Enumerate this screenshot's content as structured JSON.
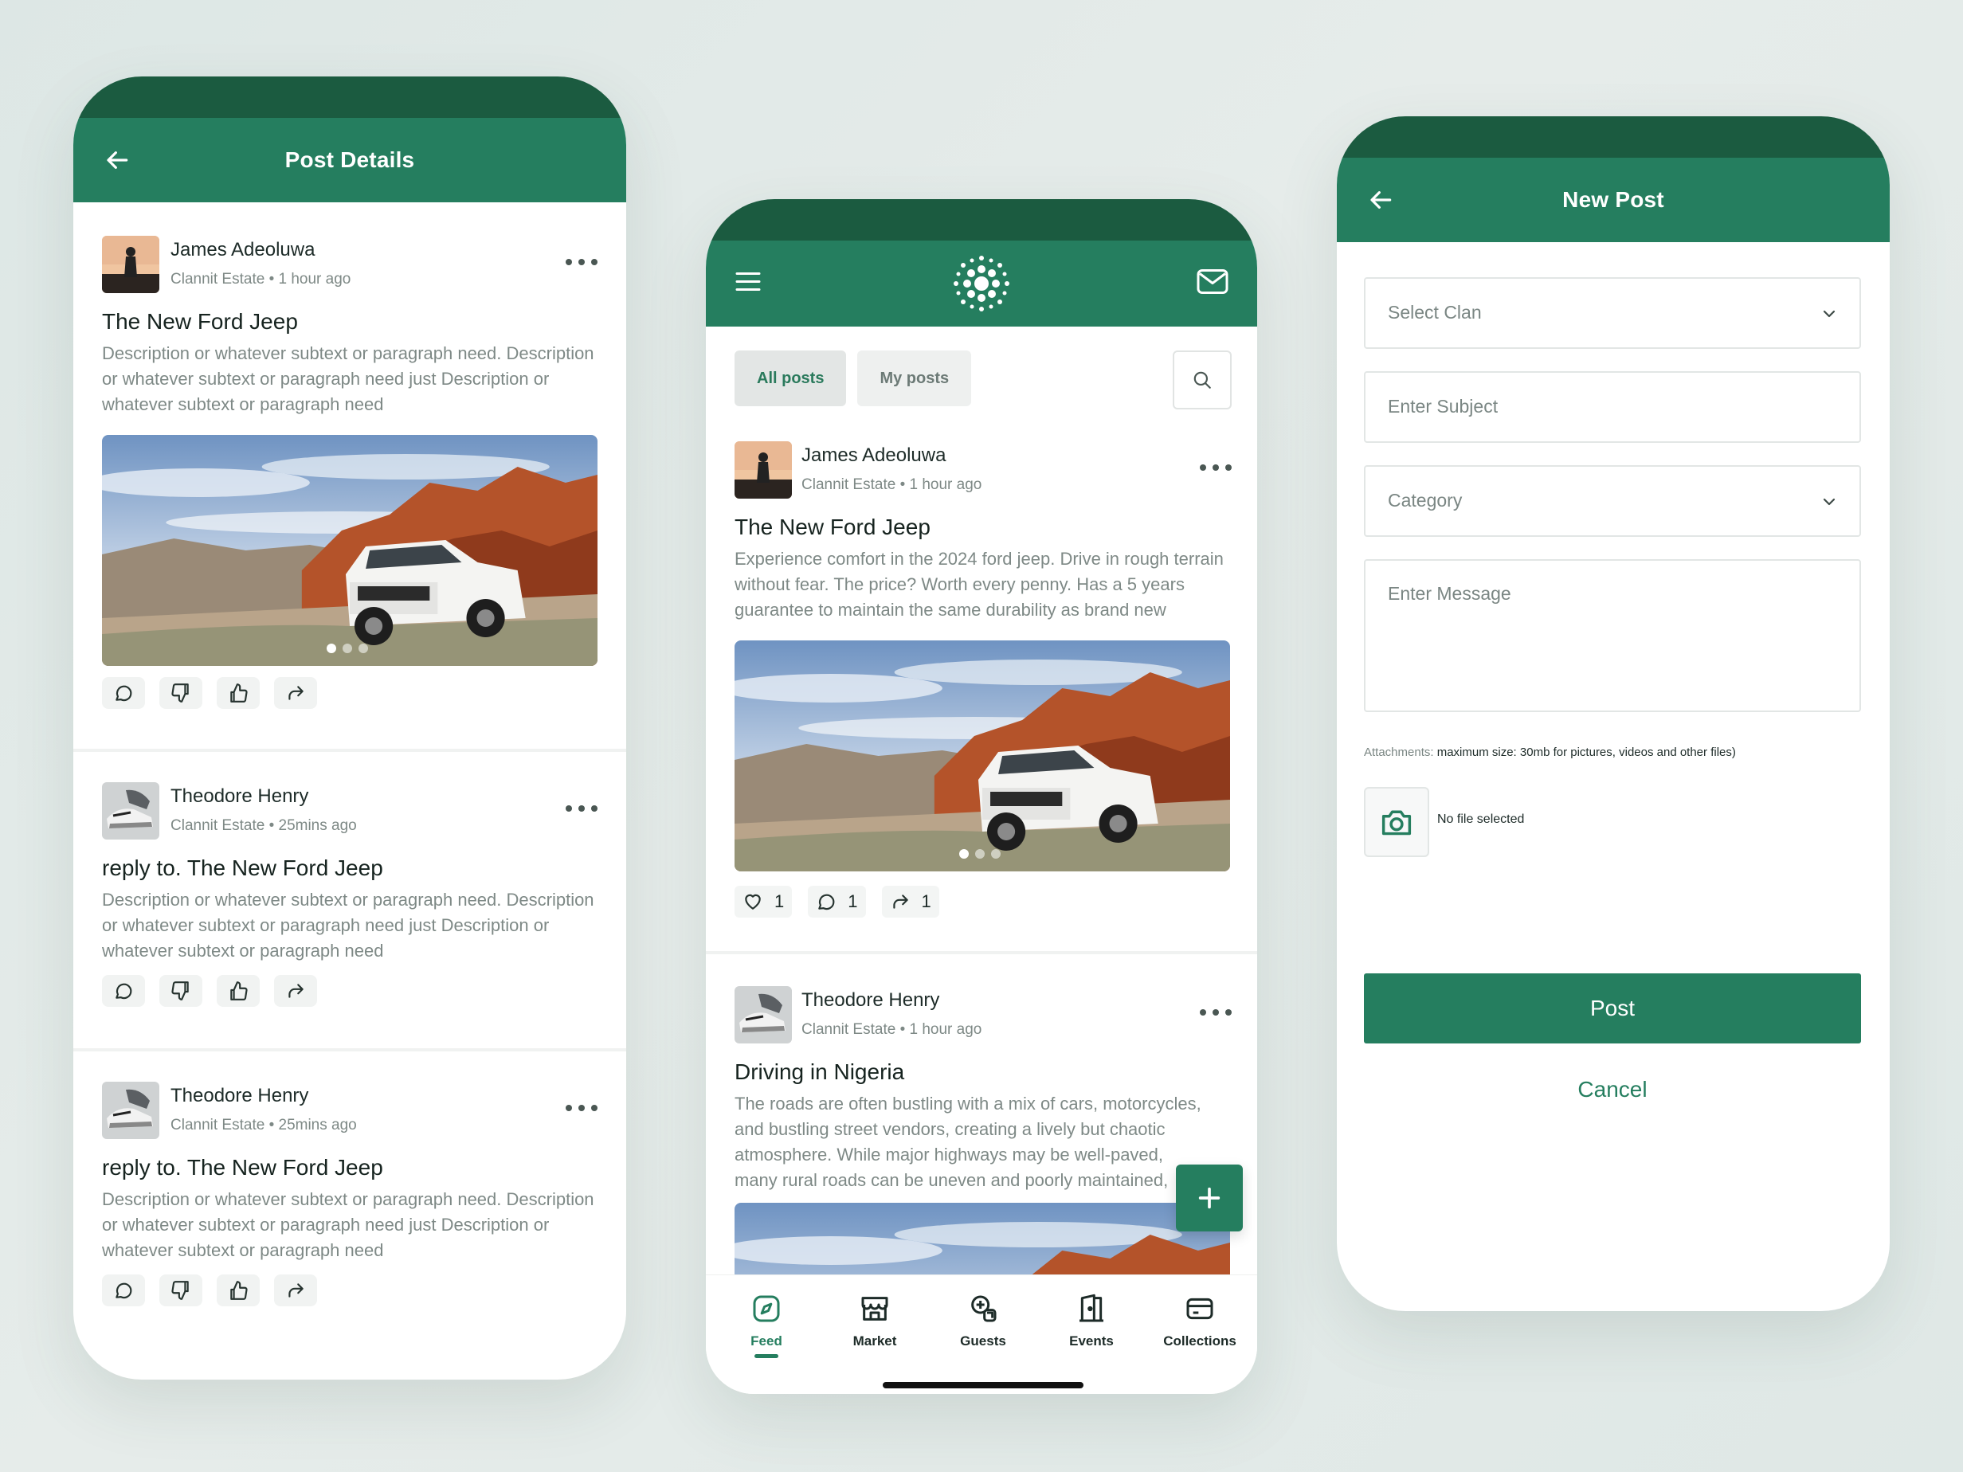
{
  "detail_screen": {
    "title": "Post Details",
    "posts": [
      {
        "author": "James Adeoluwa",
        "meta": "Clannit Estate • 1 hour ago",
        "title": "The New Ford Jeep",
        "desc": "Description or whatever subtext or paragraph need. Description or whatever subtext or paragraph need just Description or whatever subtext or paragraph need"
      },
      {
        "author": "Theodore Henry",
        "meta": "Clannit Estate • 25mins ago",
        "title": "reply to. The New Ford Jeep",
        "desc": "Description or whatever subtext or paragraph need. Description or whatever subtext or paragraph need just Description or whatever subtext or paragraph need"
      },
      {
        "author": "Theodore Henry",
        "meta": "Clannit Estate • 25mins ago",
        "title": "reply to. The New Ford Jeep",
        "desc": "Description or whatever subtext or paragraph need. Description or whatever subtext or paragraph need just Description or whatever subtext or paragraph need"
      }
    ]
  },
  "feed_screen": {
    "tabs": [
      "All posts",
      "My posts"
    ],
    "posts": [
      {
        "author": "James Adeoluwa",
        "meta": "Clannit Estate • 1 hour ago",
        "title": "The New Ford Jeep",
        "desc": "Experience comfort in the 2024 ford jeep. Drive in rough terrain without fear. The price? Worth every penny. Has a 5 years guarantee to maintain the same durability as brand new",
        "likes": "1",
        "comments": "1",
        "shares": "1"
      },
      {
        "author": "Theodore Henry",
        "meta": "Clannit Estate • 1 hour ago",
        "title": "Driving in Nigeria",
        "desc": "The roads are often bustling with a mix of cars, motorcycles, and bustling street vendors, creating a lively but chaotic atmosphere. While major highways may be well-paved, many rural roads can be uneven and poorly maintained, requiring cautious naviga"
      }
    ],
    "nav": [
      "Feed",
      "Market",
      "Guests",
      "Events",
      "Collections"
    ]
  },
  "new_post_screen": {
    "title": "New Post",
    "select_clan": "Select Clan",
    "subject": "Enter Subject",
    "category": "Category",
    "message": "Enter Message",
    "attach_label": "Attachments:",
    "attach_text": " maximum size: 30mb for pictures, videos and other files)",
    "no_file": "No file selected",
    "post_button": "Post",
    "cancel_button": "Cancel"
  },
  "colors": {
    "primary": "#257e5f",
    "statusbar": "#1b5b40"
  }
}
